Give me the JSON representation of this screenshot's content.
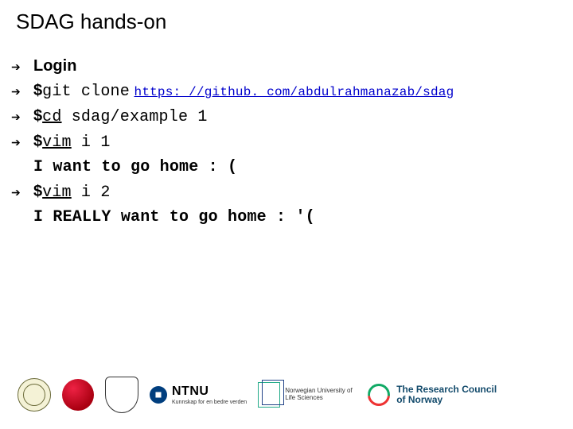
{
  "title": "SDAG hands-on",
  "bullet_glyph": "➔",
  "lines": {
    "login": "Login",
    "git_cmd_prefix": "$",
    "git_cmd": "git clone",
    "git_url": "https: //github. com/abdulrahmanazab/sdag",
    "cd_prefix": "$",
    "cd_cmd": "cd",
    "cd_arg": " sdag/example 1",
    "vim1_prefix": "$",
    "vim1_cmd": "vim",
    "vim1_arg": " i 1",
    "content1": "I want to go home : (",
    "vim2_prefix": "$",
    "vim2_cmd": "vim",
    "vim2_arg": " i 2",
    "content2": "I REALLY want to go home : '("
  },
  "footer": {
    "ntnu": "NTNU",
    "ntnu_sub": "Kunnskap for en bedre verden",
    "nmbu": "Norwegian University of Life Sciences",
    "rcn_l1": "The Research Council",
    "rcn_l2": "of Norway"
  }
}
